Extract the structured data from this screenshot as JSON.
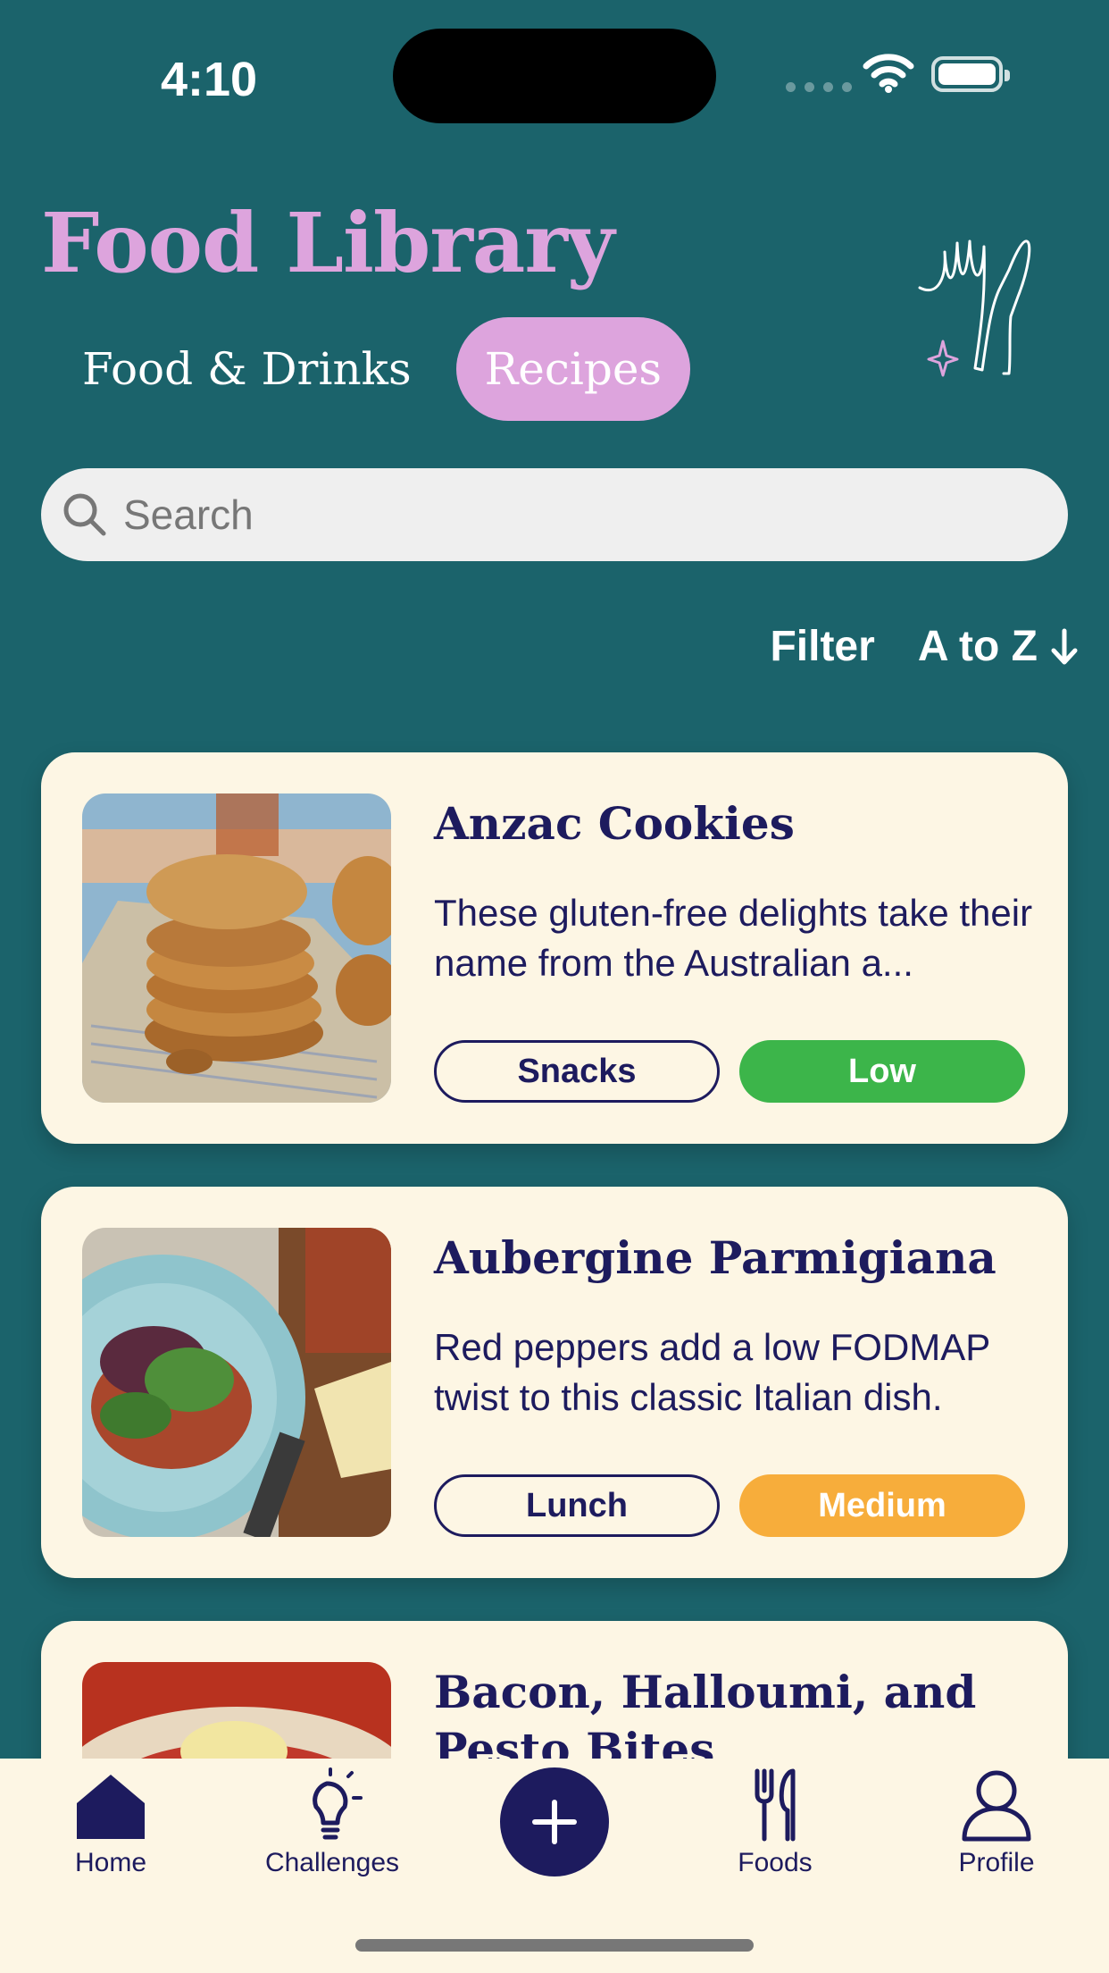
{
  "status": {
    "time": "4:10"
  },
  "header": {
    "title": "Food Library"
  },
  "tabs": [
    {
      "label": "Food & Drinks",
      "active": false
    },
    {
      "label": "Recipes",
      "active": true
    }
  ],
  "search": {
    "placeholder": "Search",
    "value": ""
  },
  "sort": {
    "filter_label": "Filter",
    "order_label": "A to Z"
  },
  "recipes": [
    {
      "title": "Anzac Cookies",
      "description": "These gluten-free delights take their name from the Australian a...",
      "category": "Snacks",
      "level": "Low",
      "level_color": "#3cb54a"
    },
    {
      "title": "Aubergine Parmigiana",
      "description": "Red peppers add a low FODMAP twist to this classic Italian dish.",
      "category": "Lunch",
      "level": "Medium",
      "level_color": "#f7ad3b"
    },
    {
      "title": "Bacon, Halloumi, and Pesto Bites",
      "description": "",
      "category": "",
      "level": "",
      "level_color": ""
    }
  ],
  "tabbar": {
    "items": [
      {
        "label": "Home",
        "icon": "home-icon"
      },
      {
        "label": "Challenges",
        "icon": "lightbulb-icon"
      },
      {
        "label": "",
        "icon": "plus-icon"
      },
      {
        "label": "Foods",
        "icon": "fork-knife-icon"
      },
      {
        "label": "Profile",
        "icon": "person-icon"
      }
    ]
  },
  "colors": {
    "background": "#1b636b",
    "accent_pink": "#dda4dd",
    "card": "#fdf6e4",
    "navy": "#1d1b5e"
  }
}
